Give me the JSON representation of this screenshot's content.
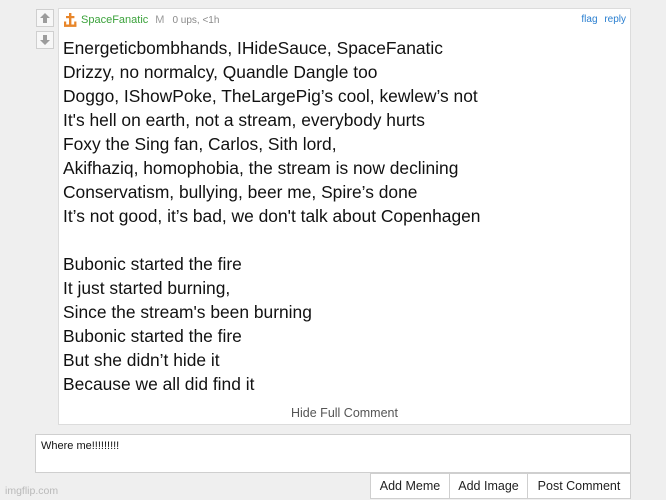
{
  "comment": {
    "username": "SpaceFanatic",
    "badge": "M",
    "stats": "0 ups, <1h",
    "actions": {
      "flag": "flag",
      "reply": "reply"
    },
    "lines": [
      "Energeticbombhands, IHideSauce, SpaceFanatic",
      "Drizzy, no normalcy, Quandle Dangle too",
      "Doggo, IShowPoke, TheLargePig’s cool, kewlew’s not",
      "It's hell on earth, not a stream, everybody hurts",
      "Foxy the Sing fan, Carlos, Sith lord,",
      "Akifhaziq, homophobia, the stream is now declining",
      "Conservatism, bullying, beer me, Spire’s done",
      "It’s not good, it’s bad, we don't talk about Copenhagen",
      "",
      "Bubonic started the fire",
      "It just started burning,",
      "Since the stream's been burning",
      "Bubonic started the fire",
      "But she didn’t hide it",
      "Because we all did find it"
    ],
    "hide_full_label": "Hide Full Comment"
  },
  "reply_box": {
    "value": "Where me!!!!!!!!!"
  },
  "buttons": {
    "add_meme": "Add Meme",
    "add_image": "Add Image",
    "post_comment": "Post Comment"
  },
  "watermark": "imgflip.com",
  "colors": {
    "username": "#3ba23b",
    "link": "#2a7fd0",
    "avatar": "#e8862a"
  },
  "icons": {
    "upvote": "arrow-up-icon",
    "downvote": "arrow-down-icon",
    "avatar": "anchor-avatar-icon"
  }
}
